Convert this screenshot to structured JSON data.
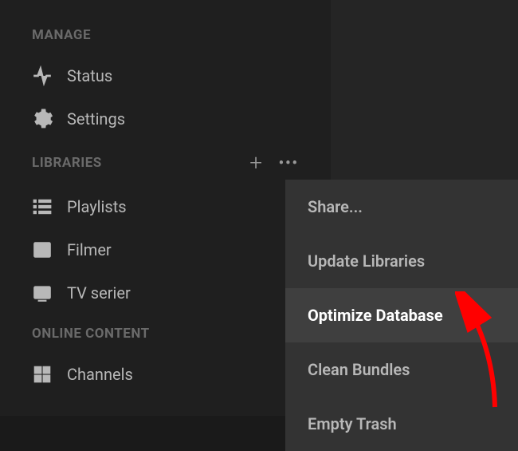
{
  "sidebar": {
    "sections": {
      "manage": {
        "header": "MANAGE",
        "items": [
          {
            "label": "Status"
          },
          {
            "label": "Settings"
          }
        ]
      },
      "libraries": {
        "header": "LIBRARIES",
        "items": [
          {
            "label": "Playlists"
          },
          {
            "label": "Filmer"
          },
          {
            "label": "TV serier"
          }
        ]
      },
      "online": {
        "header": "ONLINE CONTENT",
        "items": [
          {
            "label": "Channels"
          }
        ]
      }
    }
  },
  "contextMenu": {
    "items": [
      {
        "label": "Share..."
      },
      {
        "label": "Update Libraries"
      },
      {
        "label": "Optimize Database"
      },
      {
        "label": "Clean Bundles"
      },
      {
        "label": "Empty Trash"
      }
    ],
    "highlightedIndex": 2
  }
}
